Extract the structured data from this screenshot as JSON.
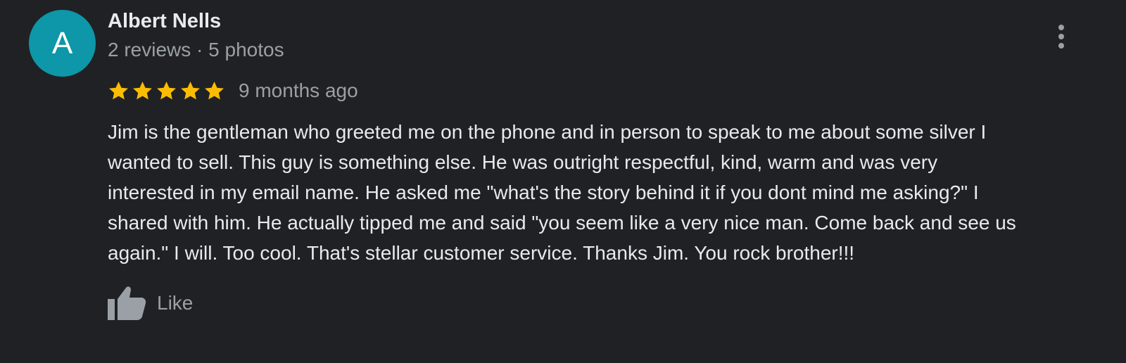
{
  "review": {
    "author": {
      "initial": "A",
      "name": "Albert Nells",
      "meta": "2 reviews · 5 photos",
      "avatar_color": "#0d97a8"
    },
    "rating": {
      "stars": 5,
      "max_stars": 5,
      "star_color": "#fbbc04"
    },
    "time": "9 months ago",
    "text_lines": [
      "Jim is the gentleman who greeted me on the phone and in person to speak to me about some silver I",
      "wanted to sell. This guy is something else. He was outright respectful, kind, warm and was very",
      "interested in my email name. He asked me \"what's the story behind it if you dont mind me asking?\" I",
      "shared with him. He actually tipped me and said \"you seem like a very nice man. Come back and see us",
      "again.\" I will. Too cool. That's stellar customer service. Thanks Jim. You rock brother!!!"
    ],
    "actions": {
      "like_label": "Like",
      "like_icon": "thumbs-up-icon",
      "more_icon": "more-vert-icon"
    }
  },
  "colors": {
    "background": "#202124",
    "primary_text": "#e8eaed",
    "secondary_text": "#9aa0a6"
  }
}
